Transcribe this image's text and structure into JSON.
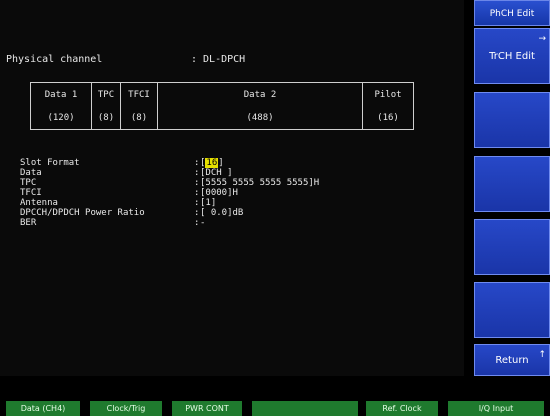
{
  "screen": {
    "channel_label": "Physical channel",
    "channel_value": ": DL-DPCH"
  },
  "slot_table": [
    {
      "name": "Data 1",
      "bits": "(120)"
    },
    {
      "name": "TPC",
      "bits": "(8)"
    },
    {
      "name": "TFCI",
      "bits": "(8)"
    },
    {
      "name": "Data 2",
      "bits": "(488)"
    },
    {
      "name": "Pilot",
      "bits": "(16)"
    }
  ],
  "params": [
    {
      "label": "Slot Format",
      "value_pre": "[",
      "highlight": "16",
      "value_post": "]"
    },
    {
      "label": "Data",
      "value": "[DCH     ]"
    },
    {
      "label": "TPC",
      "value": "[5555 5555 5555 5555]H"
    },
    {
      "label": "TFCI",
      "value": "[0000]H"
    },
    {
      "label": "Antenna",
      "value": "[1]"
    },
    {
      "label": "DPCCH/DPDCH Power Ratio",
      "value": "[  0.0]dB"
    },
    {
      "label": "BER",
      "value": "-"
    }
  ],
  "softkeys": {
    "title": "PhCH Edit",
    "keys": [
      {
        "label": "TrCH Edit",
        "mark": "→"
      },
      {
        "label": ""
      },
      {
        "label": ""
      },
      {
        "label": ""
      },
      {
        "label": ""
      },
      {
        "label": "Return",
        "mark": "↑"
      }
    ]
  },
  "function_keys": [
    {
      "label": "Data (CH4)"
    },
    {
      "label": "Clock/Trig"
    },
    {
      "label": "PWR CONT"
    },
    {
      "label": ""
    },
    {
      "label": "Ref. Clock"
    },
    {
      "label": "I/Q Input"
    }
  ],
  "colors": {
    "softkey_blue": "#1f3fb8",
    "highlight_yellow": "#e6e000",
    "fkey_green": "#1f7a2e"
  }
}
